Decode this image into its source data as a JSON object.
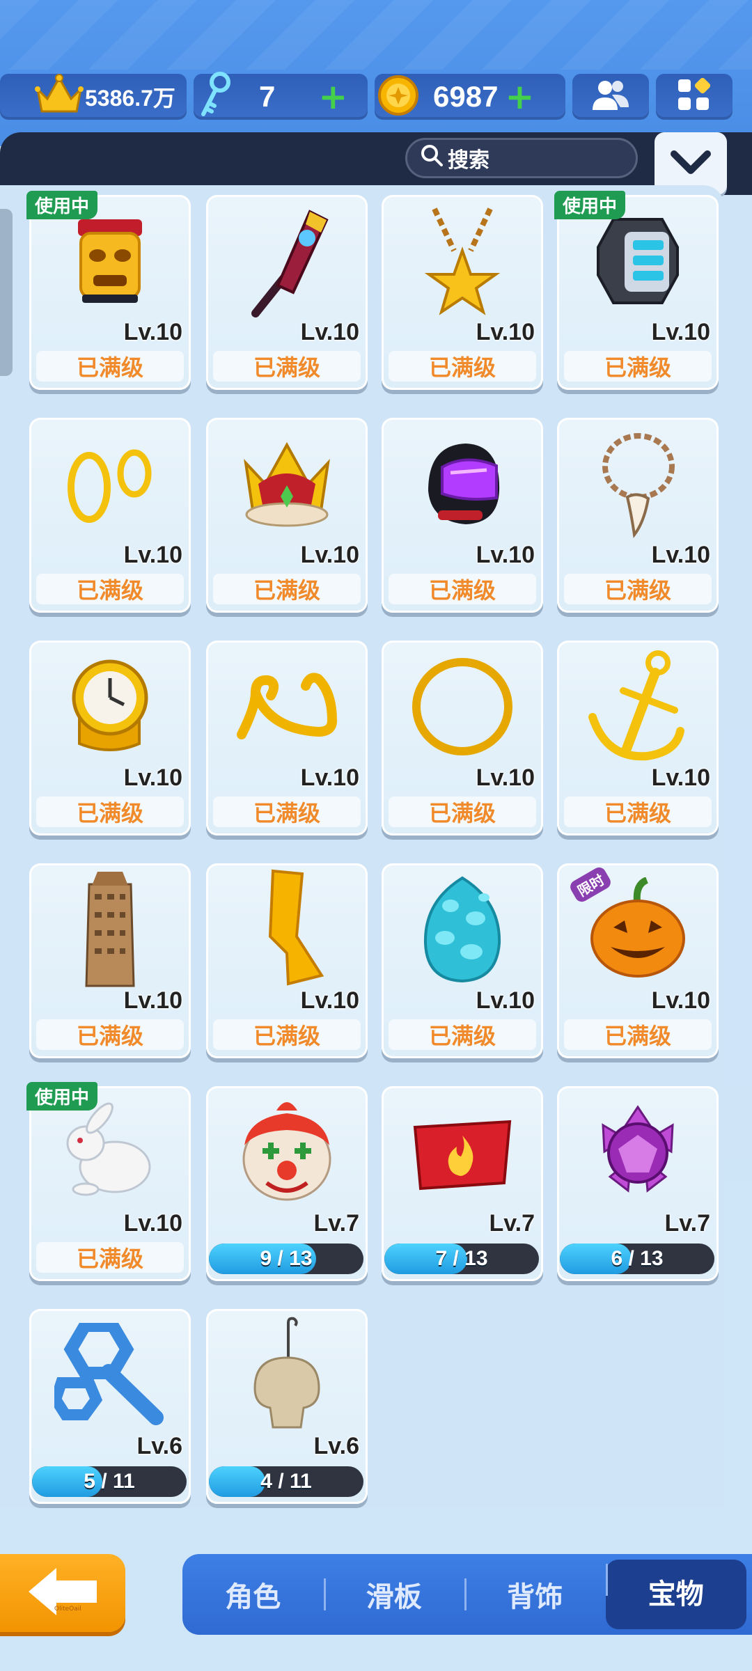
{
  "currency": {
    "crown_value": "5386.7万",
    "key_value": "7",
    "coin_value": "6987",
    "plus": "+"
  },
  "search": {
    "label": "搜索"
  },
  "items": [
    {
      "icon": "tiki-mask-icon",
      "level": "Lv.10",
      "status": "已满级",
      "in_use": true
    },
    {
      "icon": "fire-axe-icon",
      "level": "Lv.10",
      "status": "已满级",
      "in_use": false
    },
    {
      "icon": "star-necklace-icon",
      "level": "Lv.10",
      "status": "已满级",
      "in_use": false
    },
    {
      "icon": "smart-watch-icon",
      "level": "Lv.10",
      "status": "已满级",
      "in_use": true
    },
    {
      "icon": "gold-earrings-icon",
      "level": "Lv.10",
      "status": "已满级",
      "in_use": false
    },
    {
      "icon": "crown-icon",
      "level": "Lv.10",
      "status": "已满级",
      "in_use": false
    },
    {
      "icon": "helmet-icon",
      "level": "Lv.10",
      "status": "已满级",
      "in_use": false
    },
    {
      "icon": "tooth-necklace-icon",
      "level": "Lv.10",
      "status": "已满级",
      "in_use": false
    },
    {
      "icon": "watch-ring-icon",
      "level": "Lv.10",
      "status": "已满级",
      "in_use": false
    },
    {
      "icon": "gold-mustache-icon",
      "level": "Lv.10",
      "status": "已满级",
      "in_use": false
    },
    {
      "icon": "gold-ring-icon",
      "level": "Lv.10",
      "status": "已满级",
      "in_use": false
    },
    {
      "icon": "anchor-icon",
      "level": "Lv.10",
      "status": "已满级",
      "in_use": false
    },
    {
      "icon": "skyscraper-icon",
      "level": "Lv.10",
      "status": "已满级",
      "in_use": false
    },
    {
      "icon": "gold-bar-icon",
      "level": "Lv.10",
      "status": "已满级",
      "in_use": false
    },
    {
      "icon": "dragon-egg-icon",
      "level": "Lv.10",
      "status": "已满级",
      "in_use": false
    },
    {
      "icon": "pumpkin-icon",
      "level": "Lv.10",
      "status": "已满级",
      "in_use": false,
      "limited": "限时"
    },
    {
      "icon": "rabbit-icon",
      "level": "Lv.10",
      "status": "已满级",
      "in_use": true
    },
    {
      "icon": "clown-mask-icon",
      "level": "Lv.7",
      "progress": "9 / 13",
      "progress_value": 0.692
    },
    {
      "icon": "flame-hat-icon",
      "level": "Lv.7",
      "progress": "7 / 13",
      "progress_value": 0.538
    },
    {
      "icon": "purple-crystal-icon",
      "level": "Lv.7",
      "progress": "6 / 13",
      "progress_value": 0.462
    },
    {
      "icon": "wind-up-key-icon",
      "level": "Lv.6",
      "progress": "5 / 11",
      "progress_value": 0.455
    },
    {
      "icon": "skull-hook-icon",
      "level": "Lv.6",
      "progress": "4 / 11",
      "progress_value": 0.364
    }
  ],
  "in_use_label": "使用中",
  "back_small_text": "OliteOail",
  "tabs": [
    "角色",
    "滑板",
    "背饰",
    "宝物"
  ],
  "active_tab": "宝物"
}
